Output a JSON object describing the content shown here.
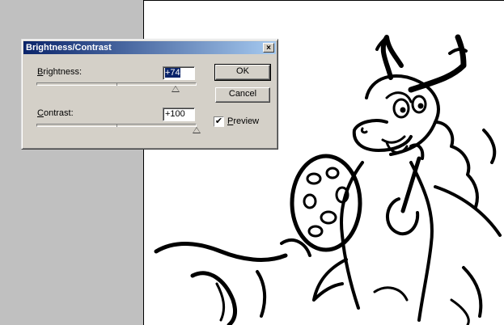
{
  "dialog": {
    "title": "Brightness/Contrast",
    "close_glyph": "×",
    "brightness": {
      "label_key": "B",
      "label_rest": "rightness:",
      "value": "+74",
      "level": 74,
      "min": -100,
      "max": 100
    },
    "contrast": {
      "label_key": "C",
      "label_rest": "ontrast:",
      "value": "+100",
      "level": 100,
      "min": -100,
      "max": 100
    },
    "ok_label": "OK",
    "cancel_label": "Cancel",
    "preview": {
      "label_key": "P",
      "label_rest": "review",
      "checked": true,
      "check_glyph": "✔"
    }
  },
  "canvas": {
    "background": "#ffffff",
    "line_color": "#000000"
  },
  "colors": {
    "titlebar_start": "#0a246a",
    "titlebar_end": "#a6caf0",
    "dialog_bg": "#d4d0c8",
    "workspace_bg": "#c0c0c0"
  }
}
